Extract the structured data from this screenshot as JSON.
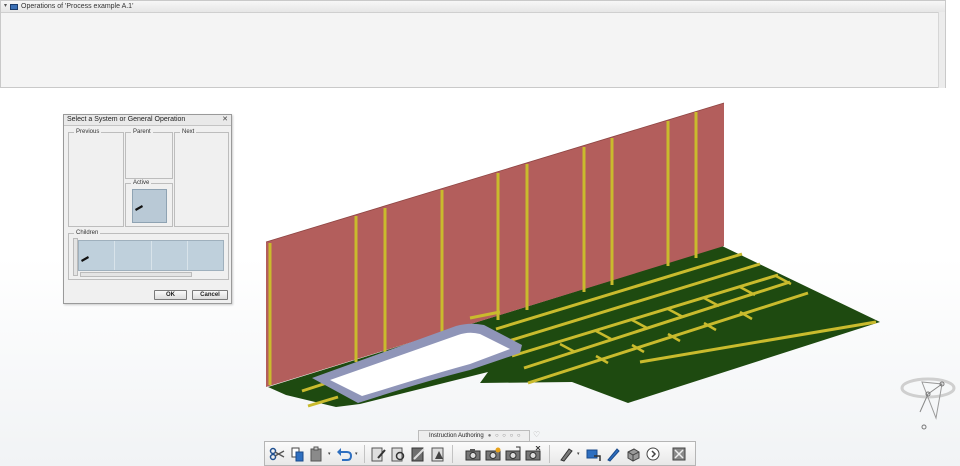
{
  "operations_panel": {
    "title": "Operations of 'Process example A.1'"
  },
  "dialog": {
    "title": "Select a System or General Operation",
    "close_glyph": "✕",
    "groups": {
      "previous": "Previous",
      "parent": "Parent",
      "next": "Next",
      "active": "Active",
      "children": "Children"
    },
    "ok_label": "OK",
    "cancel_label": "Cancel"
  },
  "instruction_tab": {
    "label": "Instruction Authoring",
    "dots": "● ○ ○ ○ ○"
  },
  "toolbar": {
    "tools": [
      {
        "icon": "cut-icon"
      },
      {
        "icon": "copy-icon"
      },
      {
        "icon": "paste-icon"
      },
      {
        "icon": "undo-icon"
      },
      {
        "icon": "edit-instruction-icon"
      },
      {
        "icon": "find-instruction-icon"
      },
      {
        "icon": "edit-document-icon"
      },
      {
        "icon": "annotation-icon"
      },
      {
        "icon": "camera-icon"
      },
      {
        "icon": "camera-new-icon"
      },
      {
        "icon": "camera-update-icon"
      },
      {
        "icon": "camera-delete-icon"
      },
      {
        "icon": "measure-icon"
      },
      {
        "icon": "position-icon"
      },
      {
        "icon": "pencil-icon"
      },
      {
        "icon": "box-icon"
      },
      {
        "icon": "play-icon"
      },
      {
        "icon": "settings-icon"
      }
    ]
  },
  "colors": {
    "wall": "#b35e5c",
    "floor": "#1e4a10",
    "beam": "#c7b82a",
    "cutout_frame": "#8f95b8"
  }
}
